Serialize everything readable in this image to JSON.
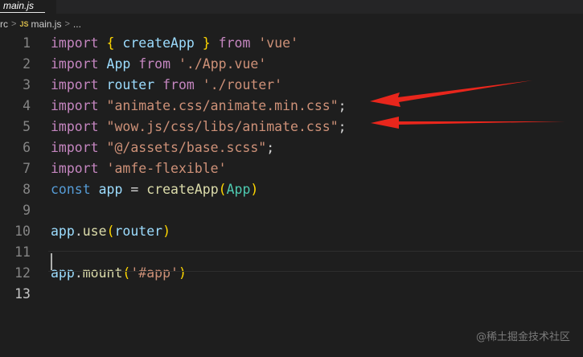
{
  "tab": {
    "filename": "main.js"
  },
  "breadcrumb": {
    "folder": "rc",
    "file_icon": "JS",
    "file": "main.js",
    "more": "..."
  },
  "lines": [
    {
      "num": "1",
      "tokens": [
        {
          "t": "import",
          "c": "kw"
        },
        {
          "t": " "
        },
        {
          "t": "{",
          "c": "b1"
        },
        {
          "t": " "
        },
        {
          "t": "createApp",
          "c": "var"
        },
        {
          "t": " "
        },
        {
          "t": "}",
          "c": "b1"
        },
        {
          "t": " "
        },
        {
          "t": "from",
          "c": "kw"
        },
        {
          "t": " "
        },
        {
          "t": "'vue'",
          "c": "str"
        }
      ]
    },
    {
      "num": "2",
      "tokens": [
        {
          "t": "import",
          "c": "kw"
        },
        {
          "t": " "
        },
        {
          "t": "App",
          "c": "var"
        },
        {
          "t": " "
        },
        {
          "t": "from",
          "c": "kw"
        },
        {
          "t": " "
        },
        {
          "t": "'./App.vue'",
          "c": "str"
        }
      ]
    },
    {
      "num": "3",
      "tokens": [
        {
          "t": "import",
          "c": "kw"
        },
        {
          "t": " "
        },
        {
          "t": "router",
          "c": "var"
        },
        {
          "t": " "
        },
        {
          "t": "from",
          "c": "kw"
        },
        {
          "t": " "
        },
        {
          "t": "'./router'",
          "c": "str"
        }
      ]
    },
    {
      "num": "4",
      "tokens": [
        {
          "t": "import",
          "c": "kw"
        },
        {
          "t": " "
        },
        {
          "t": "\"animate.css/animate.min.css\"",
          "c": "str"
        },
        {
          "t": ";"
        }
      ]
    },
    {
      "num": "5",
      "tokens": [
        {
          "t": "import",
          "c": "kw"
        },
        {
          "t": " "
        },
        {
          "t": "\"wow.js/css/libs/animate.css\"",
          "c": "str"
        },
        {
          "t": ";"
        }
      ]
    },
    {
      "num": "6",
      "tokens": [
        {
          "t": "import",
          "c": "kw"
        },
        {
          "t": " "
        },
        {
          "t": "\"@/assets/base.scss\"",
          "c": "str"
        },
        {
          "t": ";"
        }
      ]
    },
    {
      "num": "7",
      "tokens": [
        {
          "t": "import",
          "c": "kw"
        },
        {
          "t": " "
        },
        {
          "t": "'amfe-flexible'",
          "c": "str"
        }
      ]
    },
    {
      "num": "8",
      "tokens": [
        {
          "t": "const",
          "c": "decl"
        },
        {
          "t": " "
        },
        {
          "t": "app",
          "c": "var"
        },
        {
          "t": " = "
        },
        {
          "t": "createApp",
          "c": "fn"
        },
        {
          "t": "(",
          "c": "b1"
        },
        {
          "t": "App",
          "c": "cls"
        },
        {
          "t": ")",
          "c": "b1"
        }
      ]
    },
    {
      "num": "9",
      "tokens": []
    },
    {
      "num": "10",
      "tokens": [
        {
          "t": "app",
          "c": "var"
        },
        {
          "t": "."
        },
        {
          "t": "use",
          "c": "fn"
        },
        {
          "t": "(",
          "c": "b1"
        },
        {
          "t": "router",
          "c": "var"
        },
        {
          "t": ")",
          "c": "b1"
        }
      ]
    },
    {
      "num": "11",
      "tokens": []
    },
    {
      "num": "12",
      "tokens": [
        {
          "t": "app",
          "c": "var"
        },
        {
          "t": "."
        },
        {
          "t": "mount",
          "c": "fn"
        },
        {
          "t": "(",
          "c": "b1"
        },
        {
          "t": "'#app'",
          "c": "str"
        },
        {
          "t": ")",
          "c": "b1"
        }
      ]
    },
    {
      "num": "13",
      "tokens": []
    }
  ],
  "active_line": 13,
  "annotations": {
    "arrow_color": "#e8261c"
  },
  "watermark": "@稀土掘金技术社区"
}
